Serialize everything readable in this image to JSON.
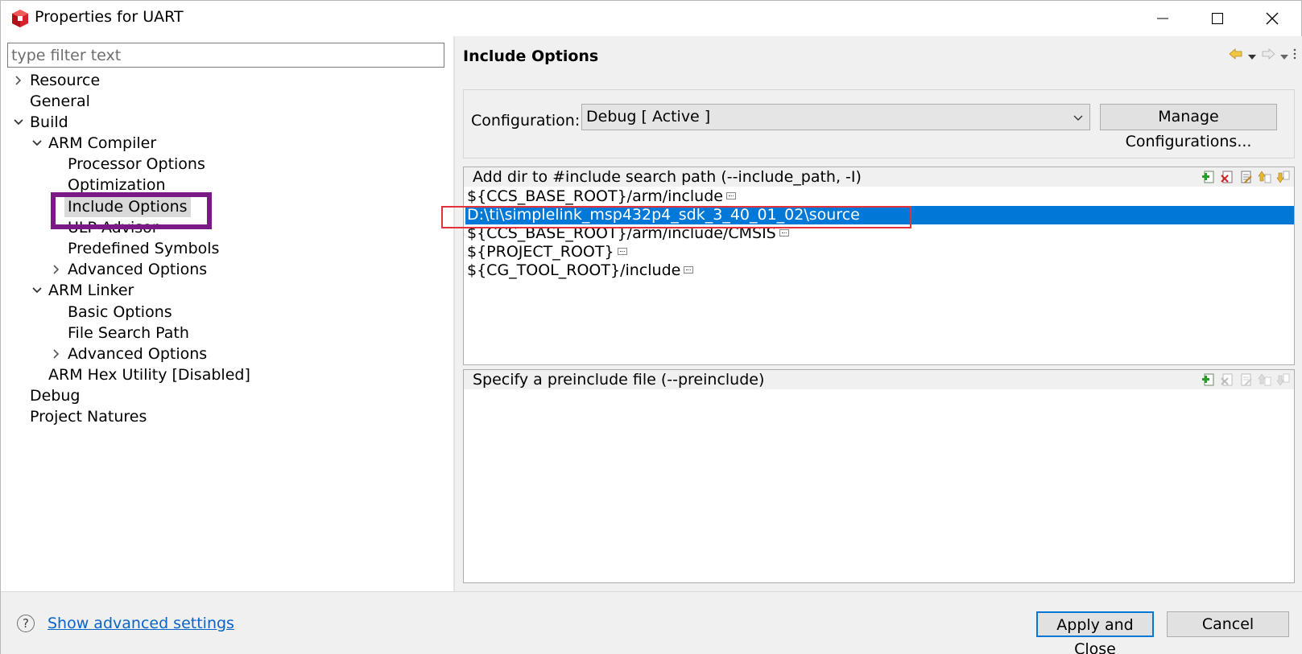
{
  "window": {
    "title": "Properties for UART"
  },
  "left": {
    "filter_placeholder": "type filter text",
    "tree": [
      {
        "label": "Resource"
      },
      {
        "label": "General"
      },
      {
        "label": "Build"
      },
      {
        "label": "ARM Compiler"
      },
      {
        "label": "Processor Options"
      },
      {
        "label": "Optimization"
      },
      {
        "label": "Include Options"
      },
      {
        "label": "ULP Advisor"
      },
      {
        "label": "Predefined Symbols"
      },
      {
        "label": "Advanced Options"
      },
      {
        "label": "ARM Linker"
      },
      {
        "label": "Basic Options"
      },
      {
        "label": "File Search Path"
      },
      {
        "label": "Advanced Options"
      },
      {
        "label": "ARM Hex Utility  [Disabled]"
      },
      {
        "label": "Debug"
      },
      {
        "label": "Project Natures"
      }
    ]
  },
  "right": {
    "page_title": "Include Options",
    "configuration_label": "Configuration:",
    "configuration_value": "Debug  [ Active ]",
    "manage_button": "Manage Configurations...",
    "include_list": {
      "header": "Add dir to #include search path (--include_path, -I)",
      "rows": [
        "${CCS_BASE_ROOT}/arm/include",
        "D:\\ti\\simplelink_msp432p4_sdk_3_40_01_02\\source",
        "${CCS_BASE_ROOT}/arm/include/CMSIS",
        "${PROJECT_ROOT}",
        "${CG_TOOL_ROOT}/include"
      ],
      "selected_index": 1
    },
    "preinclude_list": {
      "header": "Specify a preinclude file (--preinclude)",
      "rows": []
    }
  },
  "footer": {
    "advanced_link": "Show advanced settings",
    "apply_button": "Apply and Close",
    "cancel_button": "Cancel"
  },
  "colors": {
    "selection": "#0078d7",
    "annotation_purple": "#7b1a86",
    "annotation_red": "#e4323a"
  }
}
